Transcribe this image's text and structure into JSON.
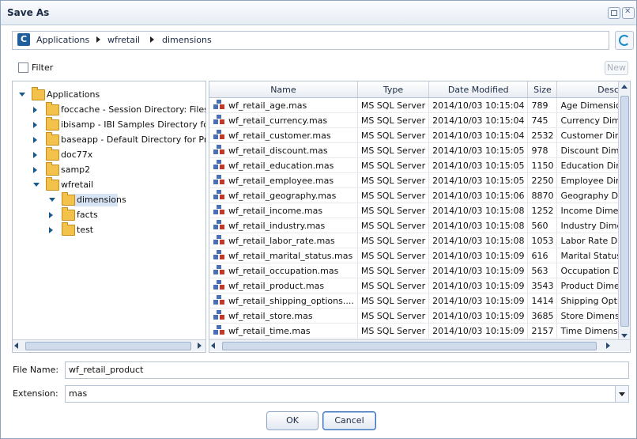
{
  "window": {
    "title": "Save As"
  },
  "path": [
    "Applications",
    "wfretail",
    "dimensions"
  ],
  "filter": {
    "label": "Filter",
    "checked": false
  },
  "new_button": "New",
  "tree": [
    {
      "label": "Applications",
      "expanded": true,
      "level": 0
    },
    {
      "label": "foccache - Session Directory: Files Los",
      "expanded": false,
      "level": 1
    },
    {
      "label": "ibisamp - IBI Samples Directory for Pro",
      "expanded": false,
      "level": 1
    },
    {
      "label": "baseapp - Default Directory for Proce",
      "expanded": false,
      "level": 1
    },
    {
      "label": "doc77x",
      "expanded": false,
      "level": 1
    },
    {
      "label": "samp2",
      "expanded": false,
      "level": 1
    },
    {
      "label": "wfretail",
      "expanded": true,
      "level": 1
    },
    {
      "label": "dimensions",
      "expanded": true,
      "level": 2,
      "selected": true
    },
    {
      "label": "facts",
      "expanded": false,
      "level": 2
    },
    {
      "label": "test",
      "expanded": false,
      "level": 2
    }
  ],
  "table": {
    "headers": [
      "Name",
      "Type",
      "Date Modified",
      "Size",
      "Description"
    ],
    "rows": [
      [
        "wf_retail_age.mas",
        "MS SQL Server",
        "2014/10/03 10:15:04",
        "789",
        "Age Dimension"
      ],
      [
        "wf_retail_currency.mas",
        "MS SQL Server",
        "2014/10/03 10:15:04",
        "745",
        "Currency Dimension"
      ],
      [
        "wf_retail_customer.mas",
        "MS SQL Server",
        "2014/10/03 10:15:04",
        "2532",
        "Customer Dimension"
      ],
      [
        "wf_retail_discount.mas",
        "MS SQL Server",
        "2014/10/03 10:15:05",
        "978",
        "Discount Dimension"
      ],
      [
        "wf_retail_education.mas",
        "MS SQL Server",
        "2014/10/03 10:15:05",
        "1150",
        "Education Dimension"
      ],
      [
        "wf_retail_employee.mas",
        "MS SQL Server",
        "2014/10/03 10:15:05",
        "2250",
        "Employee Dimension"
      ],
      [
        "wf_retail_geography.mas",
        "MS SQL Server",
        "2014/10/03 10:15:06",
        "8870",
        "Geography Dimension"
      ],
      [
        "wf_retail_income.mas",
        "MS SQL Server",
        "2014/10/03 10:15:08",
        "1252",
        "Income Dimension"
      ],
      [
        "wf_retail_industry.mas",
        "MS SQL Server",
        "2014/10/03 10:15:08",
        "560",
        "Industry Dimension"
      ],
      [
        "wf_retail_labor_rate.mas",
        "MS SQL Server",
        "2014/10/03 10:15:08",
        "1053",
        "Labor Rate Dimension"
      ],
      [
        "wf_retail_marital_status.mas",
        "MS SQL Server",
        "2014/10/03 10:15:09",
        "616",
        "Marital Status Dimension"
      ],
      [
        "wf_retail_occupation.mas",
        "MS SQL Server",
        "2014/10/03 10:15:09",
        "563",
        "Occupation Dimension"
      ],
      [
        "wf_retail_product.mas",
        "MS SQL Server",
        "2014/10/03 10:15:09",
        "3543",
        "Product Dimension"
      ],
      [
        "wf_retail_shipping_options....",
        "MS SQL Server",
        "2014/10/03 10:15:09",
        "1414",
        "Shipping Options Dimension"
      ],
      [
        "wf_retail_store.mas",
        "MS SQL Server",
        "2014/10/03 10:15:09",
        "3685",
        "Store Dimension"
      ],
      [
        "wf_retail_time.mas",
        "MS SQL Server",
        "2014/10/03 10:15:09",
        "2157",
        "Time Dimension"
      ]
    ]
  },
  "file_name": {
    "label": "File Name:",
    "value": "wf_retail_product"
  },
  "extension": {
    "label": "Extension:",
    "value": "mas"
  },
  "buttons": {
    "ok": "OK",
    "cancel": "Cancel"
  },
  "colors": {
    "accent": "#1a5a8a",
    "border": "#b7c3d3",
    "selection": "#d6e4f5"
  }
}
